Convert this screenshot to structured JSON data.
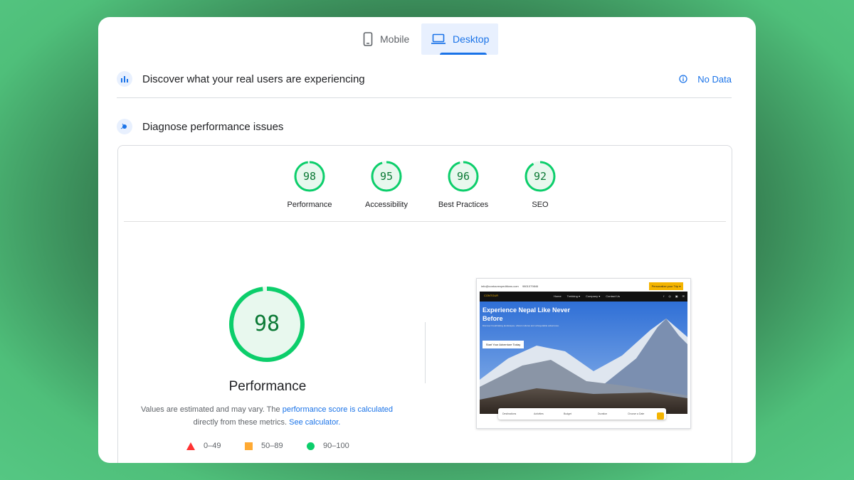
{
  "tabs": {
    "mobile": "Mobile",
    "desktop": "Desktop",
    "active": "Desktop"
  },
  "field_data": {
    "title": "Discover what your real users are experiencing",
    "status": "No Data"
  },
  "diagnose": {
    "title": "Diagnose performance issues"
  },
  "scores": [
    {
      "label": "Performance",
      "value": "98",
      "fraction": 0.98
    },
    {
      "label": "Accessibility",
      "value": "95",
      "fraction": 0.95
    },
    {
      "label": "Best Practices",
      "value": "96",
      "fraction": 0.96
    },
    {
      "label": "SEO",
      "value": "92",
      "fraction": 0.92
    }
  ],
  "performance": {
    "score": "98",
    "fraction": 0.98,
    "title": "Performance",
    "note_prefix": "Values are estimated and may vary. The ",
    "note_link": "performance score is calculated",
    "note_middle": " directly from these metrics. ",
    "note_link2": "See calculator.",
    "legend": [
      {
        "range": "0–49",
        "shape": "triangle",
        "color": "#ff3333"
      },
      {
        "range": "50–89",
        "shape": "square",
        "color": "#ffaa33"
      },
      {
        "range": "90–100",
        "shape": "circle",
        "color": "#0cce6b"
      }
    ]
  },
  "colors": {
    "pass": "#0cce6b",
    "pass_text": "#0c7a36",
    "pass_bg": "#e8f8ee",
    "accent": "#1a73e8"
  },
  "screenshot": {
    "email": "info@contourexpeditions.com",
    "phone": "9801079846",
    "cta": "Personalize your Trip ▾",
    "logo": "CONTOUR",
    "nav": [
      "Home",
      "Trekking ▾",
      "Company ▾",
      "Contact Us"
    ],
    "social": [
      "f",
      "◎",
      "▣",
      "✉"
    ],
    "hero_title": "Experience Nepal Like Never Before",
    "hero_sub": "Discover breathtaking landscapes, vibrant cultures and unforgettable adventures.",
    "hero_button": "Start Your Adventure Today",
    "search": [
      "Destinations",
      "Activities",
      "Budget",
      "Duration",
      "Choose a Date"
    ]
  }
}
